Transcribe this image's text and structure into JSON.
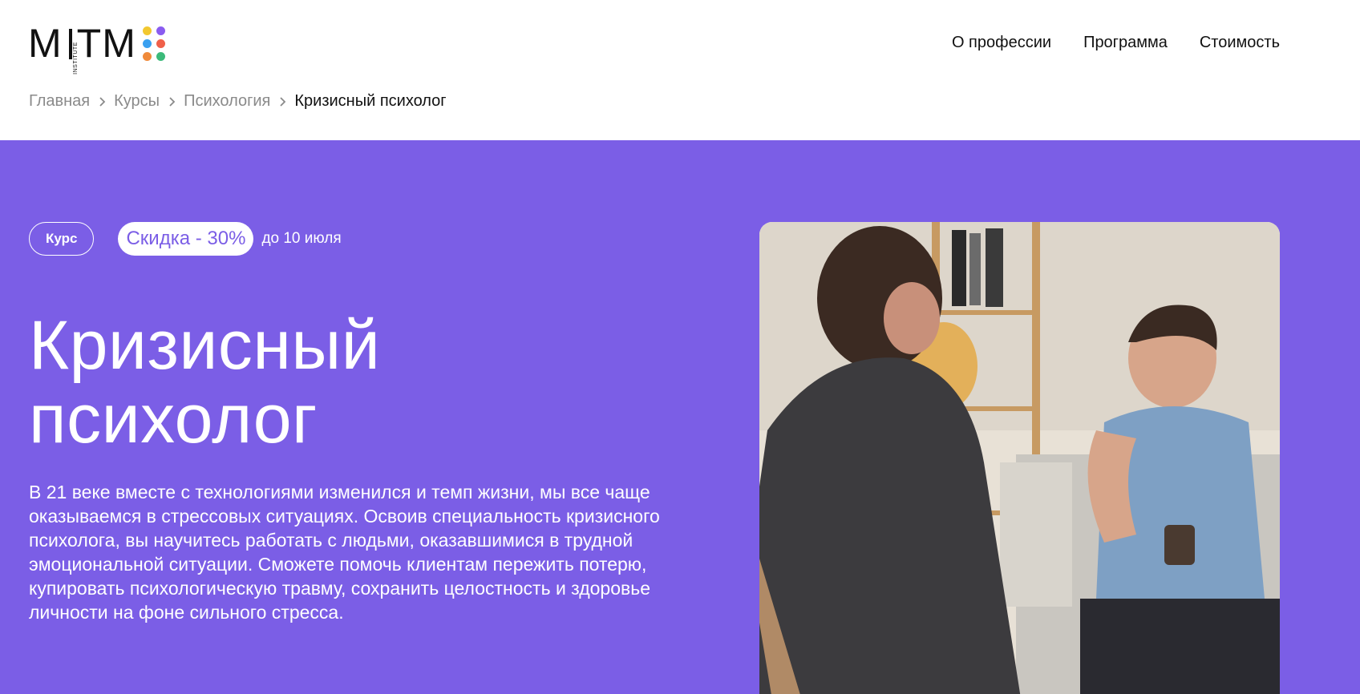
{
  "logo": {
    "text_m": "M",
    "text_tm": "TM",
    "institute": "INSTITUTE",
    "dot_colors": [
      "#f2c830",
      "#8a5cf0",
      "#3aa0f0",
      "#f0604a",
      "#f08a3a",
      "#3cba7a"
    ]
  },
  "nav": {
    "items": [
      {
        "label": "О профессии"
      },
      {
        "label": "Программа"
      },
      {
        "label": "Стоимость"
      }
    ]
  },
  "breadcrumb": {
    "items": [
      {
        "label": "Главная"
      },
      {
        "label": "Курсы"
      },
      {
        "label": "Психология"
      },
      {
        "label": "Кризисный психолог"
      }
    ]
  },
  "hero": {
    "badge_course": "Курс",
    "badge_discount": "Скидка - 30%",
    "badge_until": "до 10 июля",
    "title_line1": "Кризисный",
    "title_line2": "психолог",
    "description": "В 21 веке вместе с технологиями изменился и темп жизни, мы все чаще оказываемся в стрессовых ситуациях. Освоив специальность кризисного психолога, вы научитесь работать с людьми, оказавшимися в трудной эмоциональной ситуации. Сможете помочь клиентам пережить потерю, купировать психологическую травму, сохранить целостность и здоровье личности на фоне сильного стресса.",
    "accent_color": "#7b5ee6"
  }
}
